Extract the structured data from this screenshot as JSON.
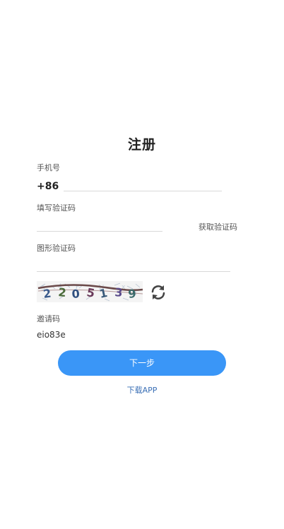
{
  "page": {
    "title": "注册"
  },
  "phone": {
    "label": "手机号",
    "country_code": "+86",
    "value": "",
    "placeholder": ""
  },
  "sms_code": {
    "label": "填写验证码",
    "value": "",
    "placeholder": "",
    "get_code_label": "获取验证码"
  },
  "image_code": {
    "label": "图形验证码",
    "value": "",
    "placeholder": "",
    "captcha_text": "2205139"
  },
  "invite": {
    "label": "邀请码",
    "value": "eio83e"
  },
  "actions": {
    "next_label": "下一步",
    "download_label": "下载APP"
  },
  "colors": {
    "primary": "#3a96f7",
    "link": "#3a6fb5"
  }
}
